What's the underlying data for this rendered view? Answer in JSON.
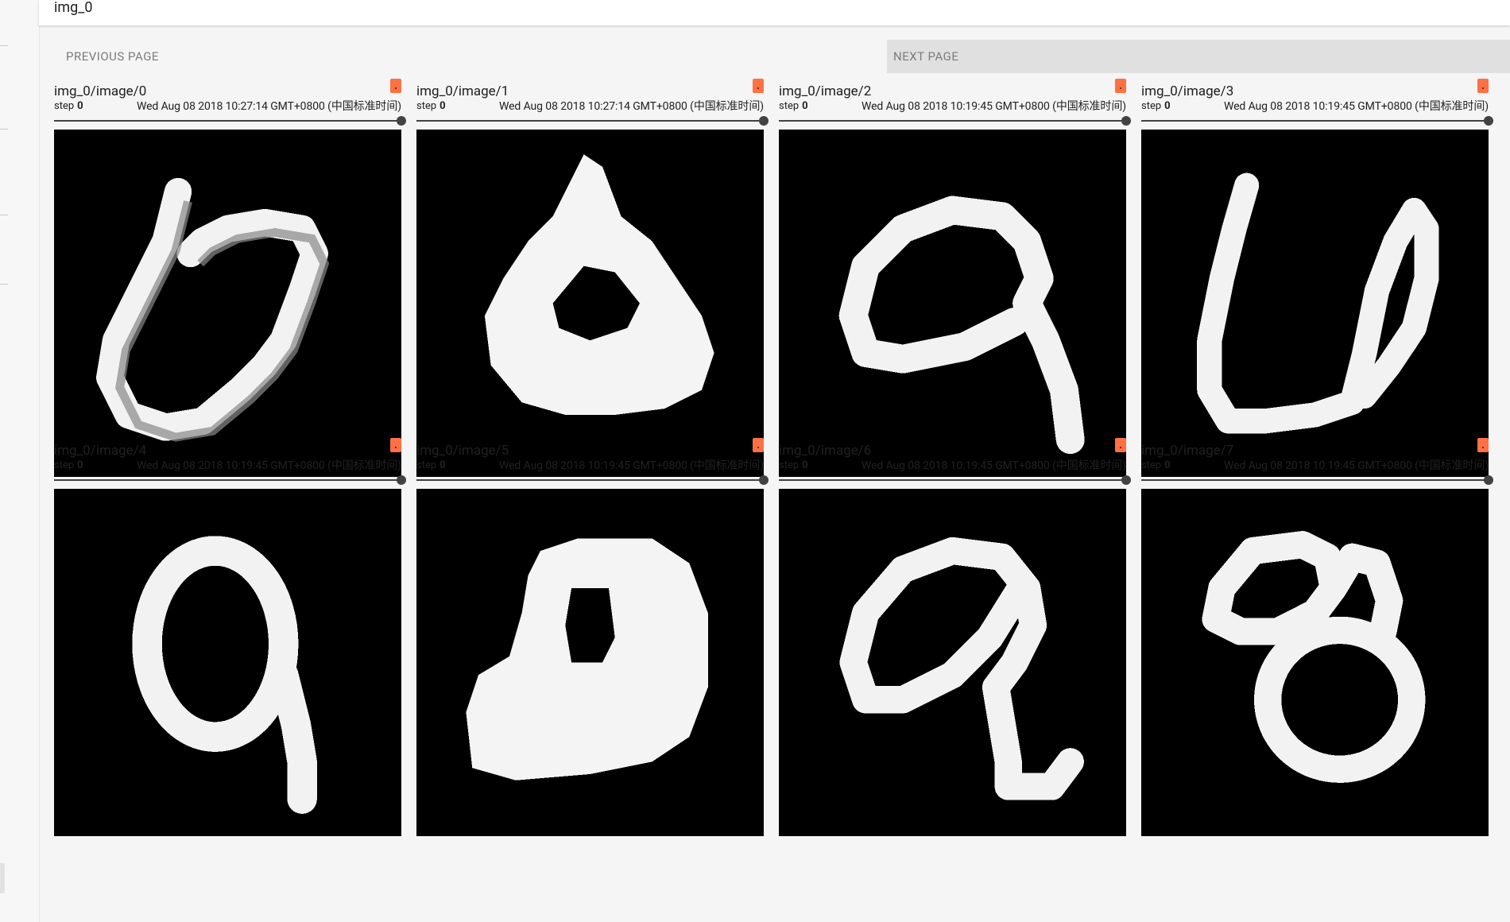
{
  "group": {
    "title": "img_0"
  },
  "pager": {
    "previous_label": "PREVIOUS PAGE",
    "next_label": "NEXT PAGE"
  },
  "colors": {
    "flag": "#ff7043",
    "slider": "#424242",
    "next_bg": "#e0e0e0"
  },
  "cards": [
    {
      "title": "img_0/image/0",
      "step_label": "step",
      "step_value": "0",
      "timestamp": "Wed Aug 08 2018 10:27:14 GMT+0800 (中国标准时间)",
      "digit_shape": "loop-6"
    },
    {
      "title": "img_0/image/1",
      "step_label": "step",
      "step_value": "0",
      "timestamp": "Wed Aug 08 2018 10:27:14 GMT+0800 (中国标准时间)",
      "digit_shape": "triangle-loop"
    },
    {
      "title": "img_0/image/2",
      "step_label": "step",
      "step_value": "0",
      "timestamp": "Wed Aug 08 2018 10:19:45 GMT+0800 (中国标准时间)",
      "digit_shape": "nine"
    },
    {
      "title": "img_0/image/3",
      "step_label": "step",
      "step_value": "0",
      "timestamp": "Wed Aug 08 2018 10:19:45 GMT+0800 (中国标准时间)",
      "digit_shape": "u-loop"
    },
    {
      "title": "img_0/image/4",
      "step_label": "step",
      "step_value": "0",
      "timestamp": "Wed Aug 08 2018 10:19:45 GMT+0800 (中国标准时间)",
      "digit_shape": "nine"
    },
    {
      "title": "img_0/image/5",
      "step_label": "step",
      "step_value": "0",
      "timestamp": "Wed Aug 08 2018 10:19:45 GMT+0800 (中国标准时间)",
      "digit_shape": "blob-loop"
    },
    {
      "title": "img_0/image/6",
      "step_label": "step",
      "step_value": "0",
      "timestamp": "Wed Aug 08 2018 10:19:45 GMT+0800 (中国标准时间)",
      "digit_shape": "nine"
    },
    {
      "title": "img_0/image/7",
      "step_label": "step",
      "step_value": "0",
      "timestamp": "Wed Aug 08 2018 10:19:45 GMT+0800 (中国标准时间)",
      "digit_shape": "eight"
    }
  ]
}
